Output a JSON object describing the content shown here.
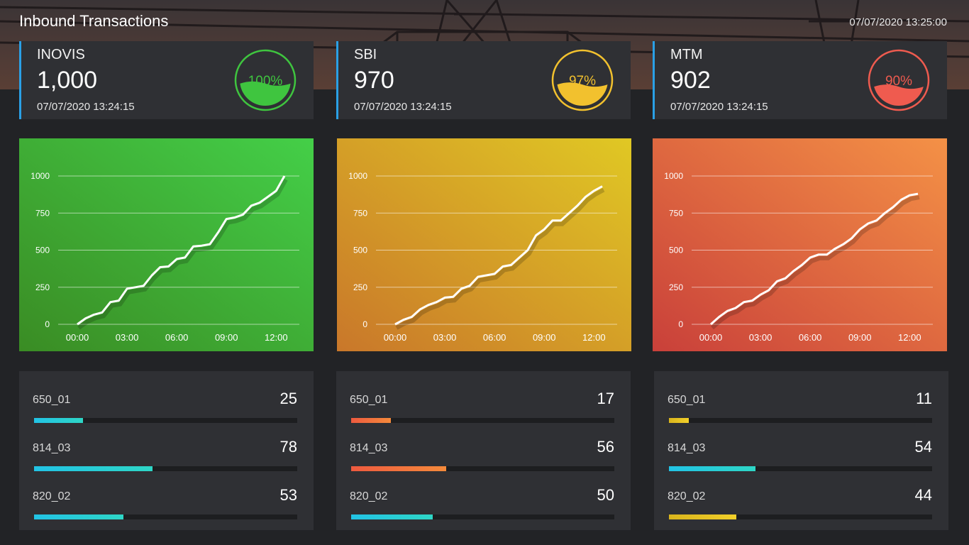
{
  "header": {
    "title": "Inbound Transactions",
    "datetime": "07/07/2020 13:25:00"
  },
  "kpis": [
    {
      "name": "INOVIS",
      "value": "1,000",
      "updated": "07/07/2020 13:24:15",
      "percent_label": "100%",
      "percent": 100,
      "color": "#3fc53f"
    },
    {
      "name": "SBI",
      "value": "970",
      "updated": "07/07/2020 13:24:15",
      "percent_label": "97%",
      "percent": 97,
      "color": "#f2c12e"
    },
    {
      "name": "MTM",
      "value": "902",
      "updated": "07/07/2020 13:24:15",
      "percent_label": "90%",
      "percent": 90,
      "color": "#ef5b4f"
    }
  ],
  "chart_data": [
    {
      "type": "line",
      "x": [
        "00:00",
        "00:30",
        "01:00",
        "01:30",
        "02:00",
        "02:30",
        "03:00",
        "03:30",
        "04:00",
        "04:30",
        "05:00",
        "05:30",
        "06:00",
        "06:30",
        "07:00",
        "07:30",
        "08:00",
        "08:30",
        "09:00",
        "09:30",
        "10:00",
        "10:30",
        "11:00",
        "11:30",
        "12:00",
        "12:15"
      ],
      "xticks": [
        "00:00",
        "03:00",
        "06:00",
        "09:00",
        "12:00"
      ],
      "yticks": [
        0,
        250,
        500,
        750,
        1000
      ],
      "ylim": [
        0,
        1000
      ],
      "series": [
        {
          "values": [
            0,
            40,
            65,
            80,
            150,
            160,
            240,
            250,
            260,
            330,
            385,
            390,
            440,
            450,
            525,
            530,
            540,
            620,
            710,
            720,
            740,
            800,
            820,
            860,
            900,
            1000
          ]
        }
      ],
      "gradient": [
        "#3a8c24",
        "#44cf48"
      ]
    },
    {
      "type": "line",
      "x": [
        "00:00",
        "00:30",
        "01:00",
        "01:30",
        "02:00",
        "02:30",
        "03:00",
        "03:30",
        "04:00",
        "04:30",
        "05:00",
        "05:30",
        "06:00",
        "06:30",
        "07:00",
        "07:30",
        "08:00",
        "08:30",
        "09:00",
        "09:30",
        "10:00",
        "10:30",
        "11:00",
        "11:30",
        "12:00",
        "12:15"
      ],
      "xticks": [
        "00:00",
        "03:00",
        "06:00",
        "09:00",
        "12:00"
      ],
      "yticks": [
        0,
        250,
        500,
        750,
        1000
      ],
      "ylim": [
        0,
        1000
      ],
      "series": [
        {
          "values": [
            0,
            30,
            50,
            100,
            130,
            150,
            180,
            185,
            240,
            260,
            320,
            330,
            340,
            390,
            400,
            450,
            500,
            600,
            640,
            700,
            700,
            750,
            800,
            860,
            900,
            930
          ]
        }
      ],
      "gradient": [
        "#c9772a",
        "#e0c824"
      ]
    },
    {
      "type": "line",
      "x": [
        "00:00",
        "00:30",
        "01:00",
        "01:30",
        "02:00",
        "02:30",
        "03:00",
        "03:30",
        "04:00",
        "04:30",
        "05:00",
        "05:30",
        "06:00",
        "06:30",
        "07:00",
        "07:30",
        "08:00",
        "08:30",
        "09:00",
        "09:30",
        "10:00",
        "10:30",
        "11:00",
        "11:30",
        "12:00",
        "12:15"
      ],
      "xticks": [
        "00:00",
        "03:00",
        "06:00",
        "09:00",
        "12:00"
      ],
      "yticks": [
        0,
        250,
        500,
        750,
        1000
      ],
      "ylim": [
        0,
        1000
      ],
      "series": [
        {
          "values": [
            0,
            50,
            90,
            110,
            150,
            160,
            200,
            230,
            290,
            310,
            360,
            400,
            450,
            470,
            470,
            510,
            540,
            580,
            640,
            680,
            700,
            750,
            790,
            840,
            870,
            880
          ]
        }
      ],
      "gradient": [
        "#c9403a",
        "#f49146"
      ]
    }
  ],
  "breakdowns": [
    [
      {
        "label": "650_01",
        "value": "25",
        "fill": 0.185,
        "colors": [
          "#22c3e5",
          "#2ed6c6"
        ]
      },
      {
        "label": "814_03",
        "value": "78",
        "fill": 0.45,
        "colors": [
          "#22c3e5",
          "#2ed6c6"
        ]
      },
      {
        "label": "820_02",
        "value": "53",
        "fill": 0.34,
        "colors": [
          "#22c3e5",
          "#2ed6c6"
        ]
      }
    ],
    [
      {
        "label": "650_01",
        "value": "17",
        "fill": 0.15,
        "colors": [
          "#ee5a3f",
          "#f58a3b"
        ]
      },
      {
        "label": "814_03",
        "value": "56",
        "fill": 0.36,
        "colors": [
          "#ee5a3f",
          "#f58a3b"
        ]
      },
      {
        "label": "820_02",
        "value": "50",
        "fill": 0.31,
        "colors": [
          "#22c3e5",
          "#2ed6c6"
        ]
      }
    ],
    [
      {
        "label": "650_01",
        "value": "11",
        "fill": 0.075,
        "colors": [
          "#d9b41c",
          "#f2d02a"
        ]
      },
      {
        "label": "814_03",
        "value": "54",
        "fill": 0.33,
        "colors": [
          "#22c3e5",
          "#2ed6c6"
        ]
      },
      {
        "label": "820_02",
        "value": "44",
        "fill": 0.255,
        "colors": [
          "#d9b41c",
          "#f2d02a"
        ]
      }
    ]
  ]
}
